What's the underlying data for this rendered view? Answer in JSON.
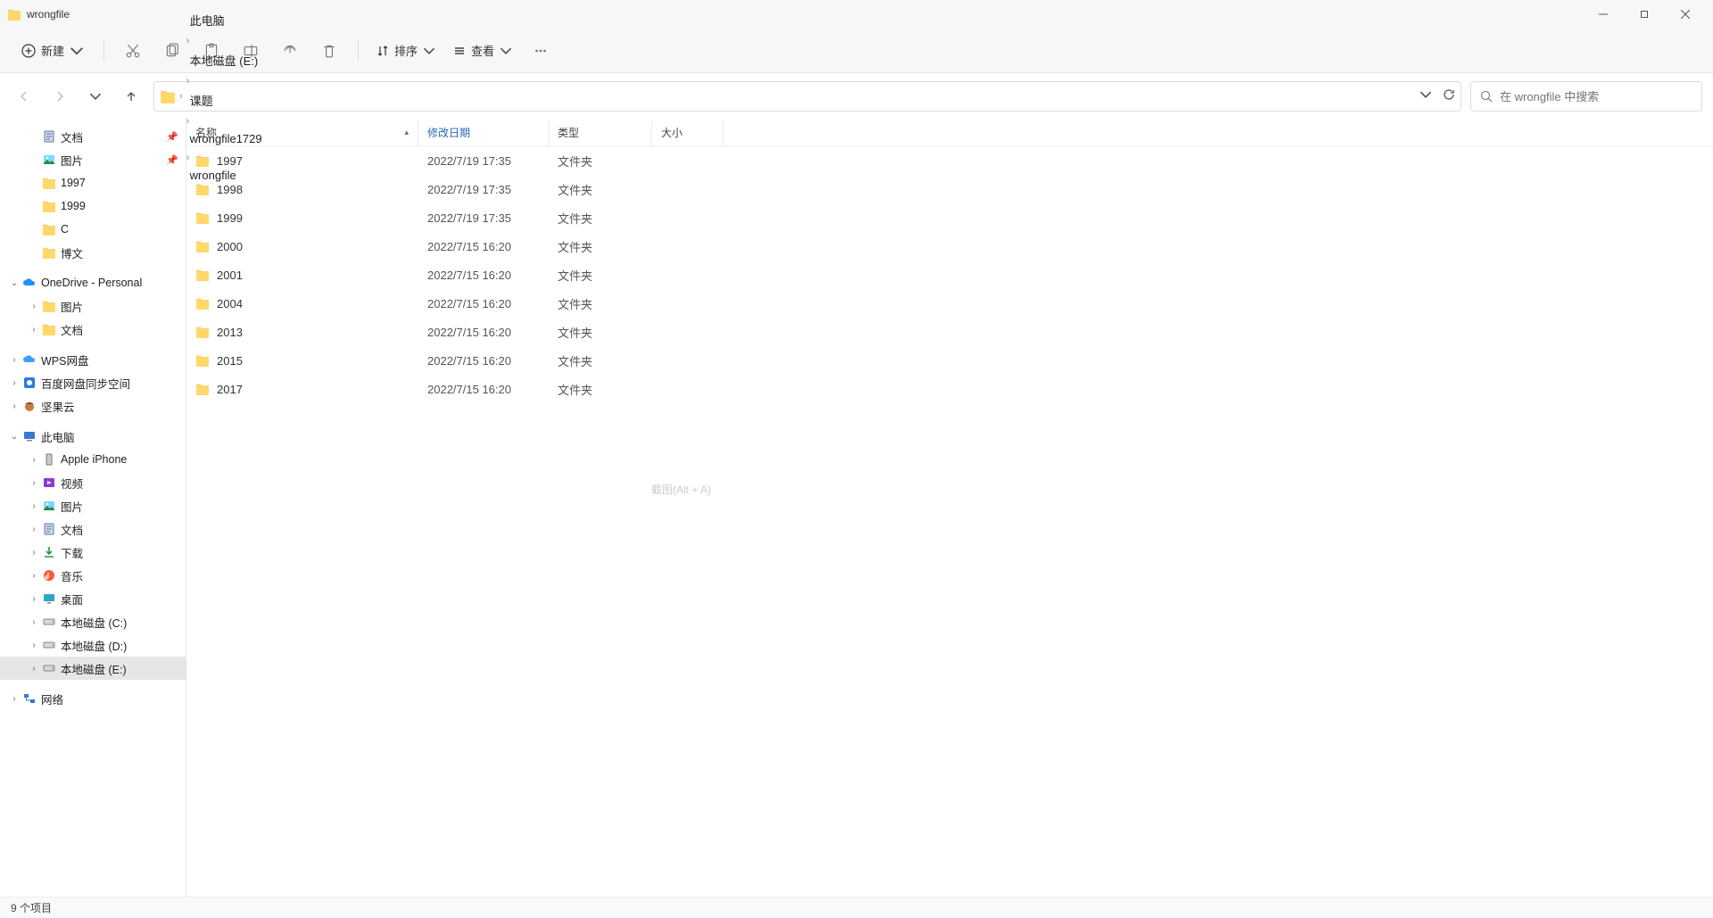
{
  "window": {
    "title": "wrongfile"
  },
  "toolbar": {
    "new_label": "新建",
    "sort_label": "排序",
    "view_label": "查看"
  },
  "breadcrumb": [
    "此电脑",
    "本地磁盘 (E:)",
    "课题",
    "wrongfile1729",
    "wrongfile"
  ],
  "search": {
    "placeholder": "在 wrongfile 中搜索"
  },
  "columns": {
    "name": "名称",
    "date": "修改日期",
    "type": "类型",
    "size": "大小"
  },
  "files": [
    {
      "name": "1997",
      "date": "2022/7/19 17:35",
      "type": "文件夹",
      "size": ""
    },
    {
      "name": "1998",
      "date": "2022/7/19 17:35",
      "type": "文件夹",
      "size": ""
    },
    {
      "name": "1999",
      "date": "2022/7/19 17:35",
      "type": "文件夹",
      "size": ""
    },
    {
      "name": "2000",
      "date": "2022/7/15 16:20",
      "type": "文件夹",
      "size": ""
    },
    {
      "name": "2001",
      "date": "2022/7/15 16:20",
      "type": "文件夹",
      "size": ""
    },
    {
      "name": "2004",
      "date": "2022/7/15 16:20",
      "type": "文件夹",
      "size": ""
    },
    {
      "name": "2013",
      "date": "2022/7/15 16:20",
      "type": "文件夹",
      "size": ""
    },
    {
      "name": "2015",
      "date": "2022/7/15 16:20",
      "type": "文件夹",
      "size": ""
    },
    {
      "name": "2017",
      "date": "2022/7/15 16:20",
      "type": "文件夹",
      "size": ""
    }
  ],
  "sidebar": {
    "quick": [
      {
        "label": "文档",
        "icon": "doc",
        "pinned": true
      },
      {
        "label": "图片",
        "icon": "pic",
        "pinned": true
      },
      {
        "label": "1997",
        "icon": "folder"
      },
      {
        "label": "1999",
        "icon": "folder"
      },
      {
        "label": "C",
        "icon": "folder"
      },
      {
        "label": "博文",
        "icon": "folder"
      }
    ],
    "onedrive": {
      "label": "OneDrive - Personal",
      "children": [
        "图片",
        "文档"
      ]
    },
    "clouds": [
      {
        "label": "WPS网盘",
        "icon": "wps"
      },
      {
        "label": "百度网盘同步空间",
        "icon": "baidu"
      },
      {
        "label": "坚果云",
        "icon": "nut"
      }
    ],
    "thispc": {
      "label": "此电脑",
      "children": [
        {
          "label": "Apple iPhone",
          "icon": "phone"
        },
        {
          "label": "视频",
          "icon": "video"
        },
        {
          "label": "图片",
          "icon": "pic"
        },
        {
          "label": "文档",
          "icon": "doc"
        },
        {
          "label": "下载",
          "icon": "download"
        },
        {
          "label": "音乐",
          "icon": "music"
        },
        {
          "label": "桌面",
          "icon": "desktop"
        },
        {
          "label": "本地磁盘 (C:)",
          "icon": "disk"
        },
        {
          "label": "本地磁盘 (D:)",
          "icon": "disk"
        },
        {
          "label": "本地磁盘 (E:)",
          "icon": "disk",
          "selected": true
        }
      ]
    },
    "network": {
      "label": "网络"
    }
  },
  "status": {
    "text": "9 个项目"
  },
  "watermark": "截图(Alt + A)"
}
